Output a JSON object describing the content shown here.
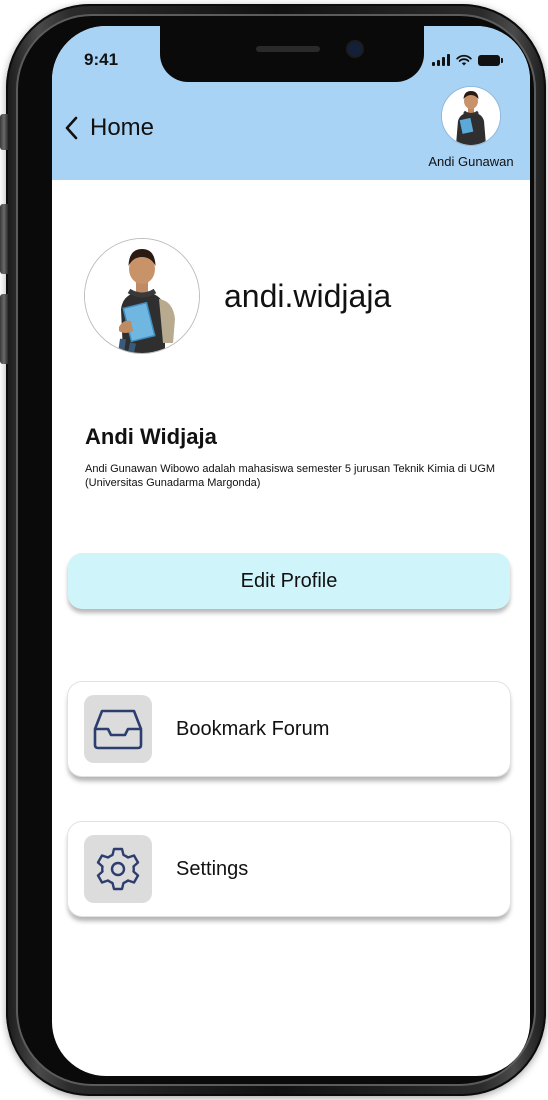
{
  "status_bar": {
    "time": "9:41"
  },
  "header": {
    "back_label": "Home",
    "user_name": "Andi Gunawan",
    "background_color": "#a9d3f5"
  },
  "profile": {
    "username": "andi.widjaja",
    "full_name": "Andi Widjaja",
    "bio": "Andi Gunawan Wibowo adalah mahasiswa semester 5 jurusan Teknik Kimia di UGM (Universitas Gunadarma Margonda)"
  },
  "actions": {
    "edit_profile_label": "Edit Profile",
    "edit_profile_color": "#cff4fa"
  },
  "menu": {
    "items": [
      {
        "label": "Bookmark Forum",
        "icon": "inbox-tray-icon"
      },
      {
        "label": "Settings",
        "icon": "gear-icon"
      }
    ]
  }
}
